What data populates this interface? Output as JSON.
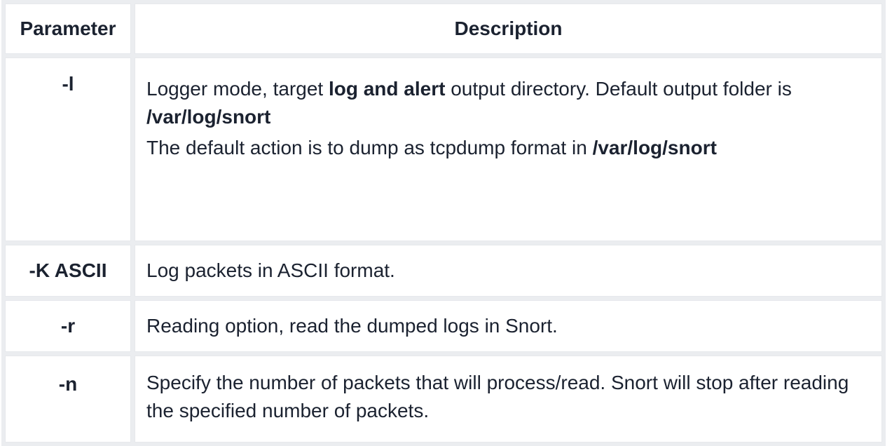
{
  "table": {
    "headers": {
      "parameter": "Parameter",
      "description": "Description"
    },
    "rows": [
      {
        "param": "-l",
        "desc": {
          "p1_a": "Logger mode, target ",
          "p1_b": "log and alert",
          "p1_c": " output directory. Default output folder is",
          "p1_d": "/var/log/snort",
          "p2_a": "The default action is to dump as tcpdump format in ",
          "p2_b": "/var/log/snort"
        }
      },
      {
        "param": "-K ASCII",
        "desc": "Log packets in ASCII format."
      },
      {
        "param": "-r",
        "desc": "Reading option, read the dumped logs in Snort."
      },
      {
        "param": "-n",
        "desc": "Specify the number of packets that will process/read. Snort will stop after reading the specified number of packets."
      }
    ]
  }
}
